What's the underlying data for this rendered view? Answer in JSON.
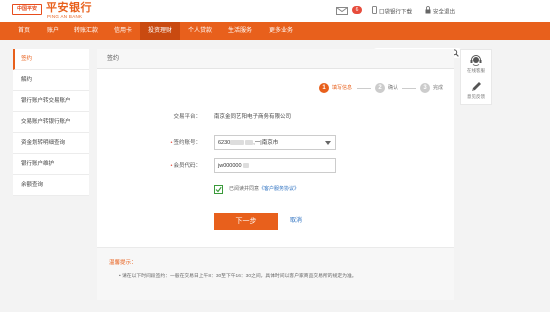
{
  "header": {
    "logo_badge": "中国平安",
    "logo_main": "平安银行",
    "logo_sub": "PING AN BANK",
    "mail_count": "6",
    "download_label": "口袋银行下载",
    "exit_label": "安全退出"
  },
  "nav": {
    "items": [
      "首页",
      "账户",
      "转账汇款",
      "信用卡",
      "投资理财",
      "个人贷款",
      "生活服务",
      "更多业务"
    ],
    "active_index": 4,
    "search_placeholder": ""
  },
  "sidebar": {
    "items": [
      "签约",
      "解约",
      "银行账户转交易账户",
      "交易账户转银行账户",
      "资金划转明细查询",
      "银行账户维护",
      "余额查询"
    ],
    "active_index": 0
  },
  "main": {
    "title": "签约",
    "steps": [
      {
        "num": "1",
        "label": "填写信息",
        "state": "active"
      },
      {
        "num": "2",
        "label": "确认",
        "state": "todo"
      },
      {
        "num": "3",
        "label": "完成",
        "state": "todo"
      }
    ],
    "platform_label": "交易平台：",
    "platform_value": "南京金同艺阳电子商务有限公司",
    "account_label": "签约账号：",
    "account_prefix": "6230",
    "account_suffix": ",一|南京市",
    "member_label": "会员代码：",
    "member_value": "jw000000",
    "agree_text": "已阅读并同意",
    "agree_link": "《客户服务协议》",
    "next_button": "下一步",
    "cancel_button": "取消",
    "tips_title": "温馨提示：",
    "tips_text": "• 请在以下时间段签约：一般在交易日上午8：30至下午16：30之间，具体时间以客户家商品交易所的规定为准。"
  },
  "float": {
    "service_label": "在线客服",
    "feedback_label": "意见反馈"
  },
  "colors": {
    "brand": "#e8601c",
    "nav_active": "#c94a10",
    "check": "#3a9a3a",
    "link": "#2a6fc0"
  }
}
